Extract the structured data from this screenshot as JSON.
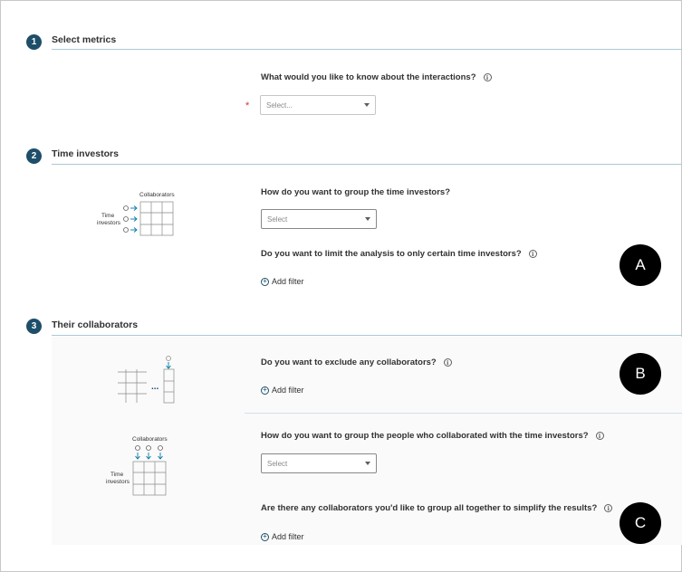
{
  "steps": [
    {
      "num": "1",
      "title": "Select metrics"
    },
    {
      "num": "2",
      "title": "Time investors"
    },
    {
      "num": "3",
      "title": "Their collaborators"
    }
  ],
  "metrics": {
    "question": "What would you like to know about the interactions?",
    "required_mark": "*",
    "dropdown_placeholder": "Select..."
  },
  "time_investors": {
    "group_question": "How do you want to group the time investors?",
    "group_dropdown": "Select",
    "limit_question": "Do you want to limit the analysis to only certain time investors?",
    "add_filter": "Add filter",
    "illustration": {
      "collaborators_label": "Collaborators",
      "time_label": "Time",
      "investors_label": "investors"
    }
  },
  "collaborators": {
    "exclude_question": "Do you want to exclude any collaborators?",
    "exclude_add_filter": "Add filter",
    "group_question": "How do you want to group the people who collaborated with the time investors?",
    "group_dropdown": "Select",
    "together_question": "Are there any collaborators you'd like to group all together to simplify the results?",
    "together_add_filter": "Add filter",
    "illustration_b": {
      "ellipsis": "..."
    },
    "illustration_c": {
      "collaborators_label": "Collaborators",
      "time_label": "Time",
      "investors_label": "investors"
    }
  },
  "badges": [
    "A",
    "B",
    "C"
  ],
  "icons": {
    "info": "info-icon",
    "plus": "plus-circle-icon",
    "chevron": "chevron-down-icon"
  },
  "colors": {
    "step_circle": "#1e4e69",
    "accent": "#0078a8",
    "required": "#d13438",
    "badge": "#000000"
  }
}
